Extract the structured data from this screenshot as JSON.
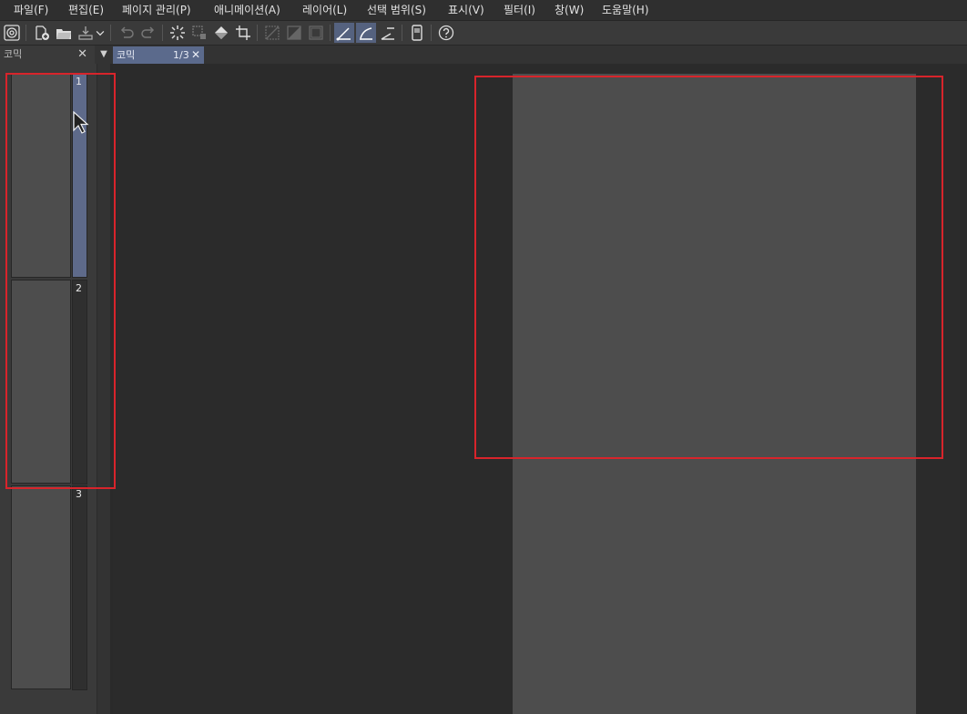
{
  "menu": [
    {
      "label": "파일(F)"
    },
    {
      "label": "편집(E)"
    },
    {
      "label": "페이지 관리(P)"
    },
    {
      "label": "애니메이션(A)"
    },
    {
      "label": "레이어(L)"
    },
    {
      "label": "선택 범위(S)"
    },
    {
      "label": "표시(V)"
    },
    {
      "label": "필터(I)"
    },
    {
      "label": "창(W)"
    },
    {
      "label": "도움말(H)"
    }
  ],
  "toolbar": {
    "icons": [
      "clip-studio-logo-icon",
      "new-file-icon",
      "open-folder-icon",
      "save-icon",
      "chevron-down-icon",
      "undo-icon",
      "redo-icon",
      "clear-icon",
      "transform-icon",
      "fill-icon",
      "crop-icon",
      "hide-selection-icon",
      "invert-selection-icon",
      "selection-border-icon",
      "snap-to-ruler-icon",
      "snap-to-special-ruler-icon",
      "snap-to-grid-icon",
      "tablet-settings-icon",
      "help-icon"
    ]
  },
  "panel": {
    "title": "코믹",
    "close": "✕"
  },
  "document_tab": {
    "title": "코믹",
    "page": "1/3",
    "close": "✕"
  },
  "pages": [
    {
      "number": "1",
      "selected": true
    },
    {
      "number": "2",
      "selected": false
    },
    {
      "number": "3",
      "selected": false
    }
  ],
  "colors": {
    "highlight": "#d8242b",
    "selected_page": "#5e6a8a",
    "paper": "#4d4d4d"
  }
}
